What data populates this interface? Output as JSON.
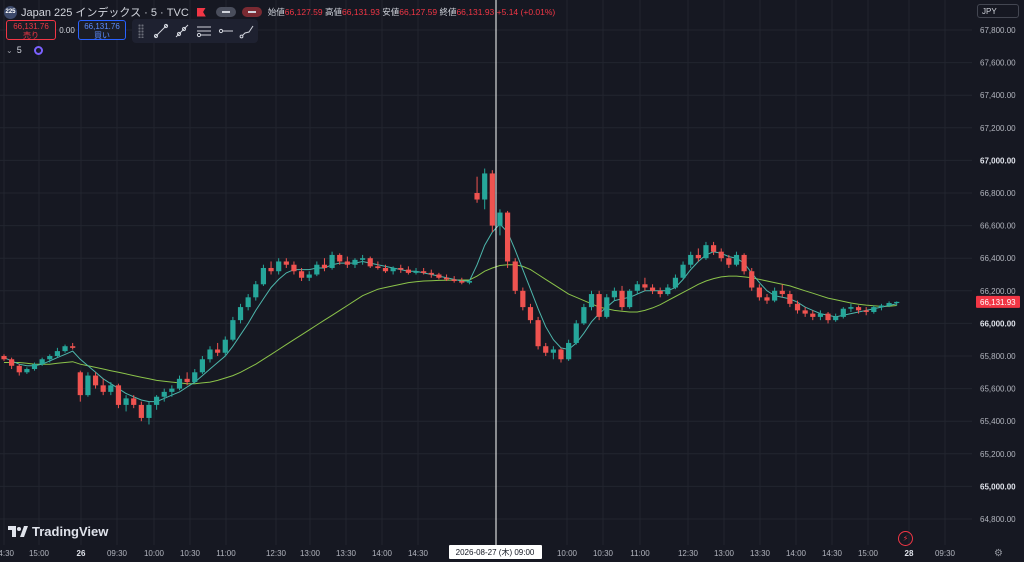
{
  "header": {
    "badge": "225",
    "title": "Japan 225 インデックス · 5 · TVC",
    "open_label": "始値",
    "open_value": "66,127.59",
    "high_label": "高値",
    "high_value": "66,131.93",
    "low_label": "安値",
    "low_value": "66,127.59",
    "close_label": "終値",
    "close_value": "66,131.93",
    "change": "+5.14 (+0.01%)"
  },
  "trade": {
    "sell_price": "66,131.76",
    "sell_label": "売り",
    "spread": "0.00",
    "buy_price": "66,131.76",
    "buy_label": "買い"
  },
  "interval": {
    "value": "5"
  },
  "currency": "JPY",
  "brand": "TradingView",
  "crosshair_label": "2026-08-27 (木)   09:00",
  "last_price_label": "66,131.93",
  "price_axis": {
    "ticks": [
      {
        "label": "67,800.00",
        "bold": false
      },
      {
        "label": "67,600.00",
        "bold": false
      },
      {
        "label": "67,400.00",
        "bold": false
      },
      {
        "label": "67,200.00",
        "bold": false
      },
      {
        "label": "67,000.00",
        "bold": true
      },
      {
        "label": "66,800.00",
        "bold": false
      },
      {
        "label": "66,600.00",
        "bold": false
      },
      {
        "label": "66,400.00",
        "bold": false
      },
      {
        "label": "66,200.00",
        "bold": false
      },
      {
        "label": "66,000.00",
        "bold": true
      },
      {
        "label": "65,800.00",
        "bold": false
      },
      {
        "label": "65,600.00",
        "bold": false
      },
      {
        "label": "65,400.00",
        "bold": false
      },
      {
        "label": "65,200.00",
        "bold": false
      },
      {
        "label": "65,000.00",
        "bold": true
      },
      {
        "label": "64,800.00",
        "bold": false
      }
    ]
  },
  "time_axis": {
    "ticks": [
      "14:30",
      "15:00",
      "26",
      "09:30",
      "10:00",
      "10:30",
      "11:00",
      "12:30",
      "13:00",
      "13:30",
      "14:00",
      "14:30",
      "10:00",
      "10:30",
      "11:00",
      "12:30",
      "13:00",
      "13:30",
      "14:00",
      "14:30",
      "15:00",
      "28",
      "09:30"
    ]
  },
  "colors": {
    "up": "#26a69a",
    "down": "#ef5350",
    "ma_short": "#4db6ac",
    "ma_long": "#8bc34a",
    "background": "#161822",
    "grid": "#22252f"
  },
  "chart_data": {
    "type": "candlestick",
    "symbol": "Japan 225",
    "interval": "5",
    "ylim": [
      64700,
      67900
    ],
    "last_price": 66131.93,
    "candles": [
      [
        65800,
        65810,
        65770,
        65780
      ],
      [
        65780,
        65790,
        65720,
        65740
      ],
      [
        65740,
        65750,
        65680,
        65700
      ],
      [
        65700,
        65730,
        65690,
        65720
      ],
      [
        65720,
        65760,
        65710,
        65750
      ],
      [
        65750,
        65790,
        65740,
        65780
      ],
      [
        65780,
        65810,
        65760,
        65800
      ],
      [
        65800,
        65850,
        65790,
        65830
      ],
      [
        65830,
        65870,
        65820,
        65860
      ],
      [
        65860,
        65880,
        65840,
        65850
      ],
      [
        65700,
        65710,
        65520,
        65560
      ],
      [
        65560,
        65700,
        65550,
        65680
      ],
      [
        65680,
        65700,
        65600,
        65620
      ],
      [
        65620,
        65660,
        65560,
        65580
      ],
      [
        65580,
        65640,
        65560,
        65620
      ],
      [
        65620,
        65630,
        65480,
        65500
      ],
      [
        65500,
        65560,
        65460,
        65540
      ],
      [
        65540,
        65560,
        65480,
        65500
      ],
      [
        65500,
        65520,
        65400,
        65420
      ],
      [
        65420,
        65520,
        65380,
        65500
      ],
      [
        65500,
        65560,
        65470,
        65550
      ],
      [
        65550,
        65600,
        65520,
        65580
      ],
      [
        65580,
        65620,
        65550,
        65600
      ],
      [
        65600,
        65680,
        65590,
        65660
      ],
      [
        65660,
        65700,
        65620,
        65640
      ],
      [
        65640,
        65720,
        65630,
        65700
      ],
      [
        65700,
        65800,
        65690,
        65780
      ],
      [
        65780,
        65860,
        65760,
        65840
      ],
      [
        65840,
        65880,
        65800,
        65820
      ],
      [
        65820,
        65920,
        65800,
        65900
      ],
      [
        65900,
        66040,
        65890,
        66020
      ],
      [
        66020,
        66120,
        66000,
        66100
      ],
      [
        66100,
        66180,
        66080,
        66160
      ],
      [
        66160,
        66260,
        66140,
        66240
      ],
      [
        66240,
        66360,
        66230,
        66340
      ],
      [
        66340,
        66380,
        66300,
        66320
      ],
      [
        66320,
        66400,
        66300,
        66380
      ],
      [
        66380,
        66400,
        66340,
        66360
      ],
      [
        66360,
        66380,
        66300,
        66320
      ],
      [
        66320,
        66340,
        66260,
        66280
      ],
      [
        66280,
        66320,
        66260,
        66300
      ],
      [
        66300,
        66380,
        66290,
        66360
      ],
      [
        66360,
        66400,
        66320,
        66340
      ],
      [
        66340,
        66440,
        66330,
        66420
      ],
      [
        66420,
        66430,
        66360,
        66380
      ],
      [
        66380,
        66410,
        66340,
        66360
      ],
      [
        66360,
        66400,
        66340,
        66390
      ],
      [
        66390,
        66420,
        66360,
        66400
      ],
      [
        66400,
        66410,
        66340,
        66350
      ],
      [
        66350,
        66380,
        66330,
        66340
      ],
      [
        66340,
        66360,
        66310,
        66320
      ],
      [
        66320,
        66350,
        66300,
        66340
      ],
      [
        66340,
        66360,
        66310,
        66330
      ],
      [
        66330,
        66350,
        66300,
        66310
      ],
      [
        66310,
        66340,
        66300,
        66320
      ],
      [
        66320,
        66340,
        66300,
        66310
      ],
      [
        66310,
        66330,
        66280,
        66300
      ],
      [
        66300,
        66310,
        66270,
        66280
      ],
      [
        66280,
        66300,
        66260,
        66270
      ],
      [
        66270,
        66290,
        66250,
        66260
      ],
      [
        66260,
        66280,
        66240,
        66250
      ],
      [
        66250,
        66270,
        66240,
        66260
      ],
      [
        66800,
        66900,
        66740,
        66760
      ],
      [
        66760,
        66950,
        66700,
        66920
      ],
      [
        66920,
        66940,
        66560,
        66600
      ],
      [
        66600,
        66700,
        66540,
        66680
      ],
      [
        66680,
        66690,
        66340,
        66380
      ],
      [
        66380,
        66400,
        66180,
        66200
      ],
      [
        66200,
        66220,
        66080,
        66100
      ],
      [
        66100,
        66120,
        66000,
        66020
      ],
      [
        66020,
        66040,
        65840,
        65860
      ],
      [
        65860,
        65880,
        65800,
        65820
      ],
      [
        65820,
        65860,
        65780,
        65840
      ],
      [
        65840,
        65850,
        65760,
        65780
      ],
      [
        65780,
        65900,
        65770,
        65880
      ],
      [
        65880,
        66020,
        65870,
        66000
      ],
      [
        66000,
        66120,
        65990,
        66100
      ],
      [
        66100,
        66200,
        66080,
        66180
      ],
      [
        66180,
        66200,
        66020,
        66040
      ],
      [
        66040,
        66180,
        66030,
        66160
      ],
      [
        66160,
        66220,
        66140,
        66200
      ],
      [
        66200,
        66230,
        66080,
        66100
      ],
      [
        66100,
        66210,
        66090,
        66200
      ],
      [
        66200,
        66260,
        66180,
        66240
      ],
      [
        66240,
        66280,
        66200,
        66220
      ],
      [
        66220,
        66240,
        66180,
        66200
      ],
      [
        66200,
        66220,
        66160,
        66180
      ],
      [
        66180,
        66240,
        66170,
        66220
      ],
      [
        66220,
        66300,
        66210,
        66280
      ],
      [
        66280,
        66380,
        66270,
        66360
      ],
      [
        66360,
        66440,
        66340,
        66420
      ],
      [
        66420,
        66460,
        66380,
        66400
      ],
      [
        66400,
        66500,
        66390,
        66480
      ],
      [
        66480,
        66500,
        66420,
        66440
      ],
      [
        66440,
        66460,
        66380,
        66400
      ],
      [
        66400,
        66420,
        66340,
        66360
      ],
      [
        66360,
        66440,
        66350,
        66420
      ],
      [
        66420,
        66430,
        66300,
        66320
      ],
      [
        66320,
        66340,
        66200,
        66220
      ],
      [
        66220,
        66240,
        66140,
        66160
      ],
      [
        66160,
        66180,
        66120,
        66140
      ],
      [
        66140,
        66220,
        66130,
        66200
      ],
      [
        66200,
        66240,
        66160,
        66180
      ],
      [
        66180,
        66200,
        66100,
        66120
      ],
      [
        66120,
        66140,
        66060,
        66080
      ],
      [
        66080,
        66100,
        66040,
        66060
      ],
      [
        66060,
        66080,
        66020,
        66040
      ],
      [
        66040,
        66080,
        66020,
        66060
      ],
      [
        66060,
        66070,
        66000,
        66020
      ],
      [
        66020,
        66060,
        66010,
        66040
      ],
      [
        66040,
        66100,
        66030,
        66090
      ],
      [
        66090,
        66120,
        66070,
        66100
      ],
      [
        66100,
        66110,
        66060,
        66080
      ],
      [
        66080,
        66100,
        66050,
        66070
      ],
      [
        66070,
        66110,
        66060,
        66100
      ],
      [
        66100,
        66120,
        66080,
        66110
      ],
      [
        66110,
        66135,
        66100,
        66125
      ],
      [
        66125,
        66135,
        66110,
        66132
      ]
    ],
    "ma_short": [
      65790,
      65770,
      65750,
      65740,
      65740,
      65750,
      65770,
      65790,
      65810,
      65830,
      65780,
      65740,
      65700,
      65660,
      65630,
      65600,
      65570,
      65550,
      65530,
      65520,
      65520,
      65540,
      65560,
      65580,
      65610,
      65640,
      65680,
      65720,
      65760,
      65800,
      65860,
      65930,
      66000,
      66080,
      66150,
      66220,
      66270,
      66310,
      66330,
      66330,
      66330,
      66340,
      66340,
      66360,
      66370,
      66370,
      66370,
      66380,
      66370,
      66360,
      66350,
      66340,
      66330,
      66320,
      66320,
      66310,
      66300,
      66290,
      66280,
      66270,
      66260,
      66260,
      66360,
      66480,
      66560,
      66610,
      66560,
      66450,
      66330,
      66210,
      66090,
      65980,
      65900,
      65850,
      65840,
      65880,
      65940,
      66010,
      66060,
      66100,
      66140,
      66150,
      66160,
      66180,
      66200,
      66200,
      66200,
      66200,
      66220,
      66270,
      66330,
      66380,
      66420,
      66440,
      66430,
      66410,
      66400,
      66370,
      66310,
      66250,
      66200,
      66170,
      66160,
      66150,
      66130,
      66100,
      66080,
      66060,
      66050,
      66040,
      66050,
      66060,
      66070,
      66080,
      66090,
      66100,
      66110,
      66120
    ],
    "ma_long": [
      65760,
      65760,
      65760,
      65755,
      65750,
      65750,
      65750,
      65755,
      65760,
      65765,
      65750,
      65740,
      65730,
      65720,
      65710,
      65700,
      65690,
      65680,
      65670,
      65660,
      65650,
      65645,
      65640,
      65635,
      65630,
      65630,
      65635,
      65640,
      65650,
      65665,
      65680,
      65700,
      65725,
      65750,
      65780,
      65810,
      65840,
      65870,
      65900,
      65930,
      65960,
      65990,
      66020,
      66050,
      66080,
      66110,
      66140,
      66170,
      66190,
      66210,
      66220,
      66230,
      66240,
      66250,
      66255,
      66260,
      66262,
      66264,
      66265,
      66266,
      66266,
      66266,
      66290,
      66320,
      66340,
      66355,
      66360,
      66360,
      66350,
      66330,
      66300,
      66270,
      66240,
      66210,
      66180,
      66160,
      66140,
      66120,
      66100,
      66090,
      66080,
      66075,
      66070,
      66070,
      66080,
      66095,
      66115,
      66140,
      66165,
      66190,
      66215,
      66240,
      66260,
      66275,
      66285,
      66290,
      66290,
      66285,
      66280,
      66270,
      66260,
      66250,
      66240,
      66230,
      66215,
      66200,
      66185,
      66170,
      66155,
      66145,
      66135,
      66125,
      66118,
      66112,
      66108,
      66104,
      66105,
      66110
    ]
  }
}
